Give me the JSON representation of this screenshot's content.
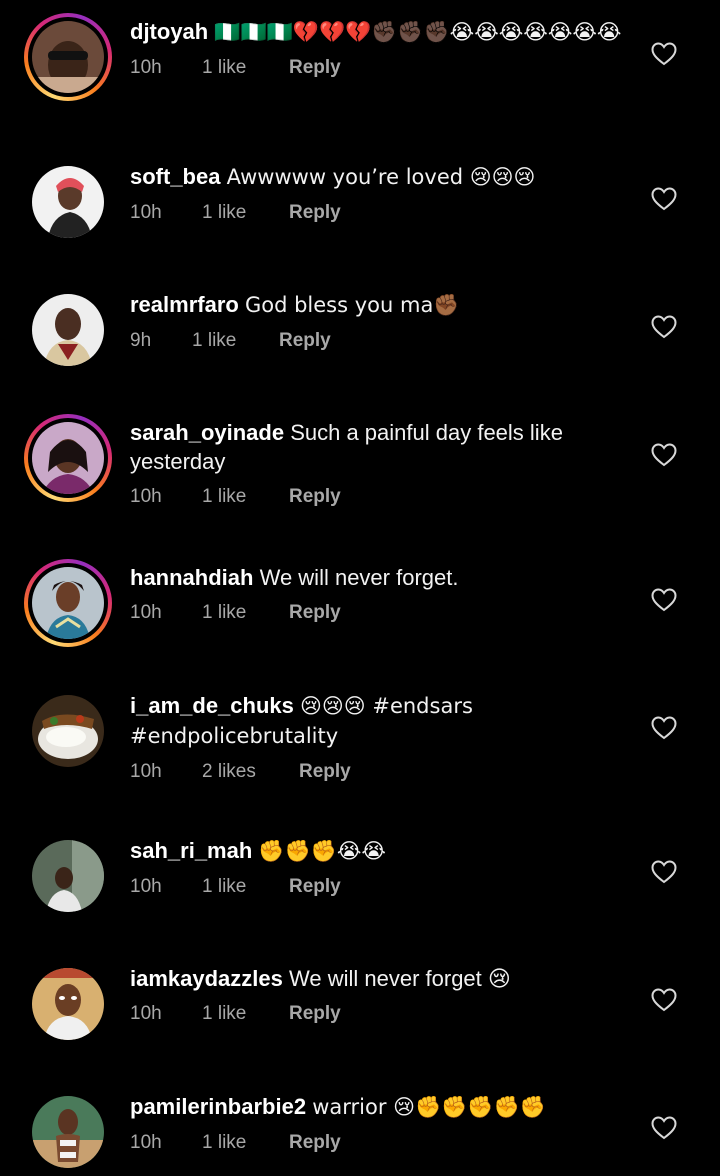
{
  "comments": [
    {
      "username": "djtoyah",
      "text": "🇳🇬🇳🇬🇳🇬💔💔💔✊🏿✊🏿✊🏿😭😭😭😭😭😭😭",
      "time": "10h",
      "likes": "1 like",
      "reply": "Reply",
      "story_ring": true
    },
    {
      "username": "soft_bea",
      "text": "Awwwww you’re loved 😢😢😢",
      "time": "10h",
      "likes": "1 like",
      "reply": "Reply",
      "story_ring": false
    },
    {
      "username": "realmrfaro",
      "text": "God bless you ma✊🏾",
      "time": "9h",
      "likes": "1 like",
      "reply": "Reply",
      "story_ring": false
    },
    {
      "username": "sarah_oyinade",
      "text": "Such a painful day feels like yesterday",
      "time": "10h",
      "likes": "1 like",
      "reply": "Reply",
      "story_ring": true
    },
    {
      "username": "hannahdiah",
      "text": "We will never forget.",
      "time": "10h",
      "likes": "1 like",
      "reply": "Reply",
      "story_ring": true
    },
    {
      "username": "i_am_de_chuks",
      "text": "😢😢😢 #endsars #endpolicebrutality",
      "time": "10h",
      "likes": "2 likes",
      "reply": "Reply",
      "story_ring": false
    },
    {
      "username": "sah_ri_mah",
      "text": "✊✊✊😭😭",
      "time": "10h",
      "likes": "1 like",
      "reply": "Reply",
      "story_ring": false
    },
    {
      "username": "iamkaydazzles",
      "text": "We will never forget 😢",
      "time": "10h",
      "likes": "1 like",
      "reply": "Reply",
      "story_ring": false
    },
    {
      "username": "pamilerinbarbie2",
      "text": "warrior 😢✊✊✊✊✊",
      "time": "10h",
      "likes": "1 like",
      "reply": "Reply",
      "story_ring": false
    }
  ],
  "icons": {
    "like": "heart-outline-icon"
  },
  "colors": {
    "background": "#000000",
    "text": "#f2f2f2",
    "meta": "#a8a8a8"
  }
}
